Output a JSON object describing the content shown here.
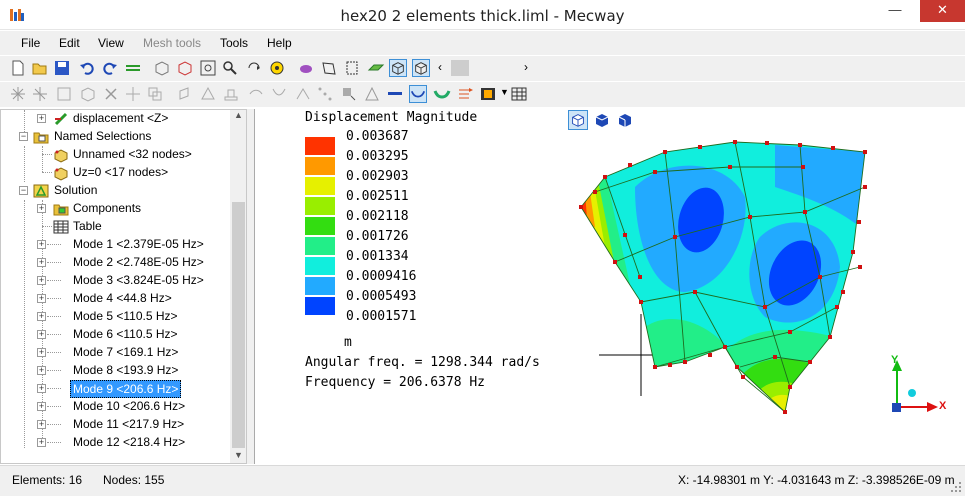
{
  "window": {
    "title": "hex20 2 elements thick.liml - Mecway",
    "min_label": "—",
    "max_label": "☐",
    "close_label": "✕"
  },
  "menu": {
    "items": [
      "File",
      "Edit",
      "View",
      "Mesh tools",
      "Tools",
      "Help"
    ],
    "disabled": [
      "Mesh tools"
    ]
  },
  "tree": {
    "items": [
      {
        "label": "displacement <Z>",
        "icon": "displacement-constraint-icon"
      },
      {
        "label": "Named Selections",
        "icon": "named-selections-folder-icon"
      },
      {
        "label": "Unnamed <32 nodes>",
        "icon": "node-selection-icon"
      },
      {
        "label": "Uz=0 <17 nodes>",
        "icon": "node-selection-icon"
      },
      {
        "label": "Solution",
        "icon": "solution-icon"
      },
      {
        "label": "Components",
        "icon": "components-folder-icon"
      },
      {
        "label": "Table",
        "icon": "table-icon"
      },
      {
        "label": "Mode 1 <2.379E-05 Hz>"
      },
      {
        "label": "Mode 2 <2.748E-05 Hz>"
      },
      {
        "label": "Mode 3 <3.824E-05 Hz>"
      },
      {
        "label": "Mode 4 <44.8 Hz>"
      },
      {
        "label": "Mode 5 <110.5 Hz>"
      },
      {
        "label": "Mode 6 <110.5 Hz>"
      },
      {
        "label": "Mode 7 <169.1 Hz>"
      },
      {
        "label": "Mode 8 <193.9 Hz>"
      },
      {
        "label": "Mode 9 <206.6 Hz>",
        "selected": true
      },
      {
        "label": "Mode 10 <206.6 Hz>"
      },
      {
        "label": "Mode 11 <217.9 Hz>"
      },
      {
        "label": "Mode 12 <218.4 Hz>"
      }
    ]
  },
  "viewport": {
    "legend_title": "Displacement Magnitude",
    "legend_values": [
      "0.003687",
      "0.003295",
      "0.002903",
      "0.002511",
      "0.002118",
      "0.001726",
      "0.001334",
      "0.0009416",
      "0.0005493",
      "0.0001571"
    ],
    "legend_colors": [
      "#ff3300",
      "#ff9900",
      "#e6f000",
      "#99ee00",
      "#33dd11",
      "#22ee88",
      "#11eedd",
      "#22aaff",
      "#0044ff"
    ],
    "unit": "m",
    "angular_freq": "Angular freq. = 1298.344 rad/s",
    "frequency": "Frequency = 206.6378 Hz",
    "axis_x": "X",
    "axis_y": "Y"
  },
  "status": {
    "elements": "Elements: 16",
    "nodes": "Nodes: 155",
    "coords": "X: -14.98301 m Y: -4.031643 m Z: -3.398526E-09 m"
  }
}
